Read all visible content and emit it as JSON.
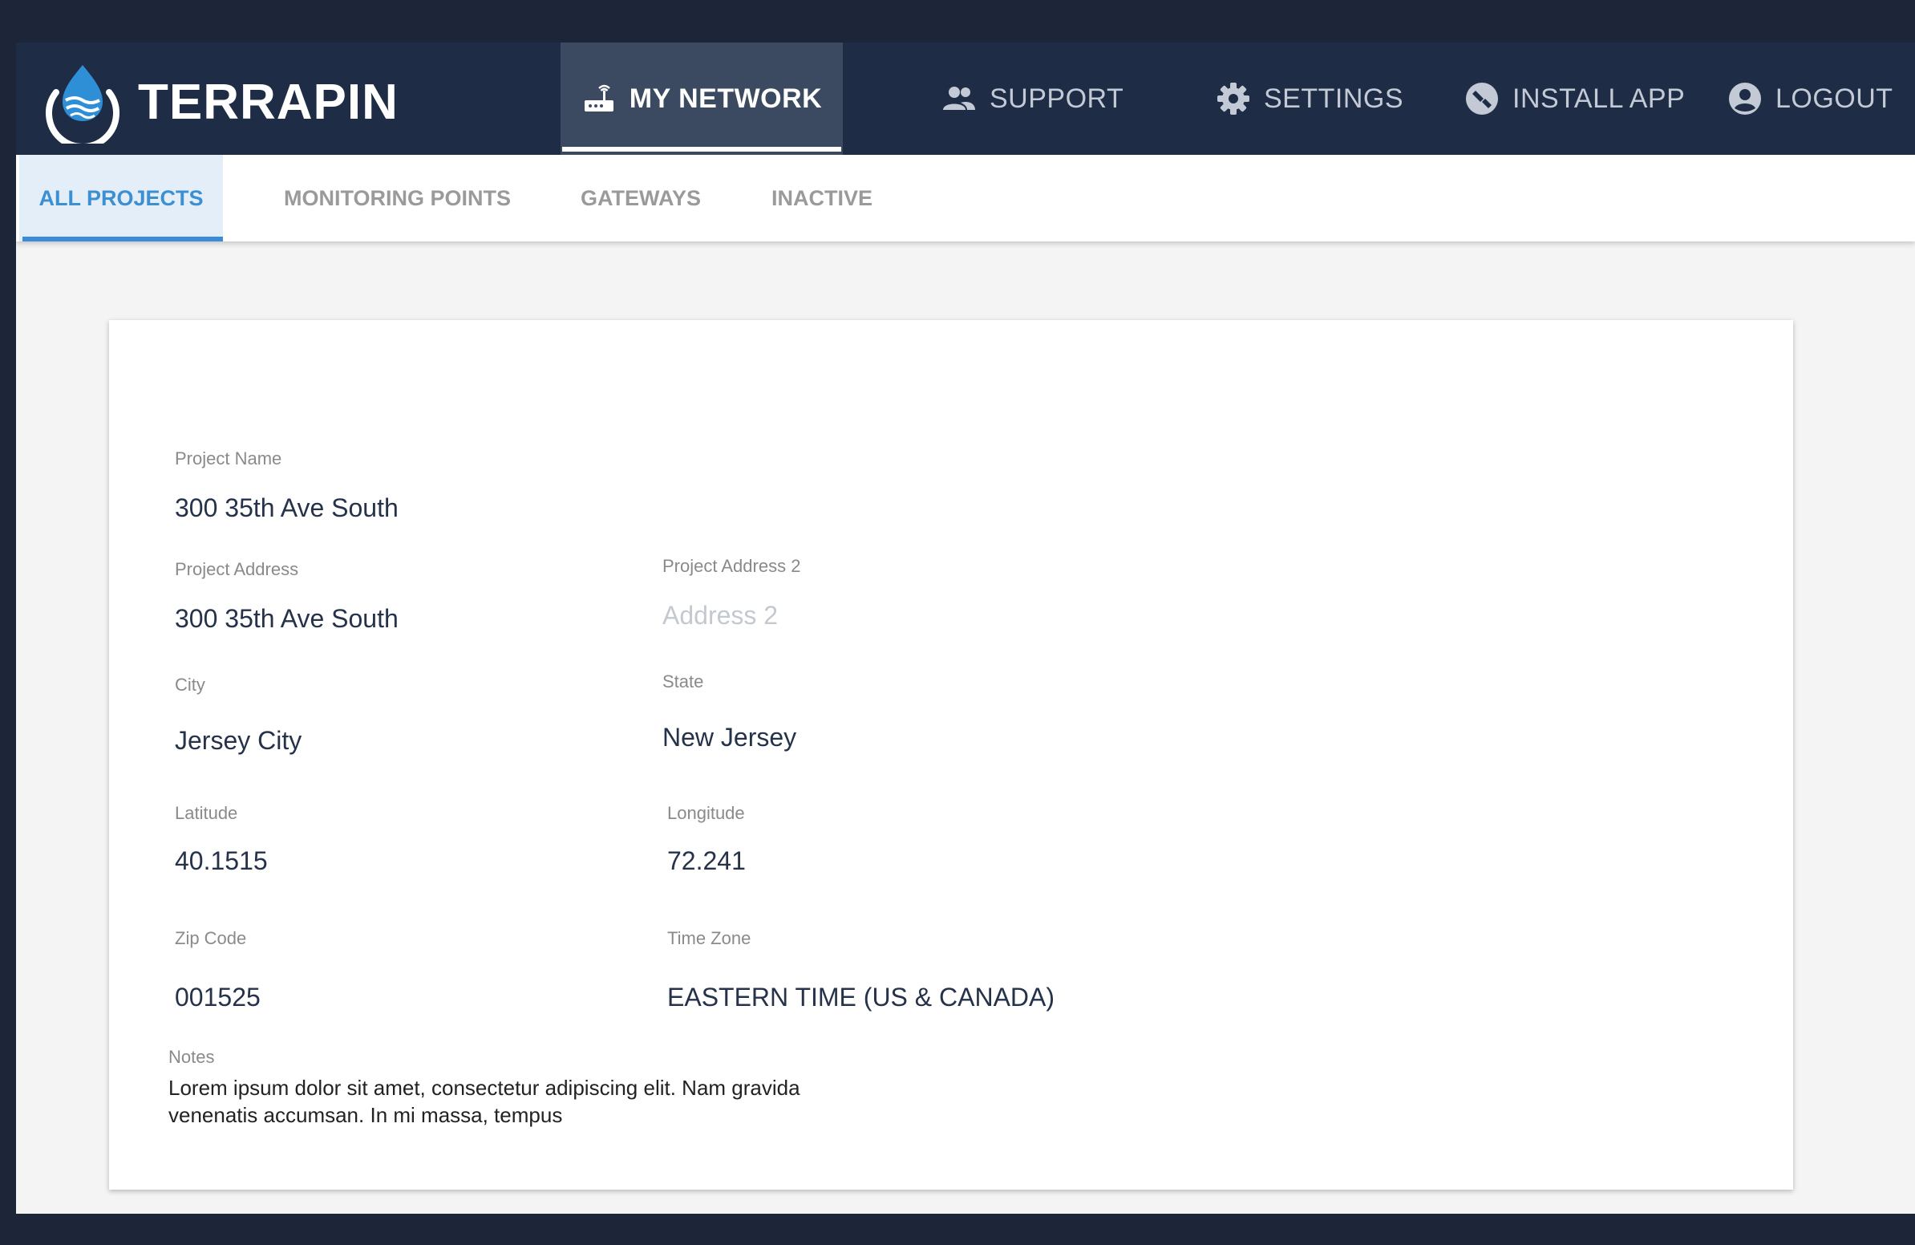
{
  "brand": {
    "name": "TERRAPIN"
  },
  "nav": {
    "items": [
      {
        "label": "MY NETWORK",
        "icon": "router-icon",
        "active": true
      },
      {
        "label": "SUPPORT",
        "icon": "people-icon"
      },
      {
        "label": "SETTINGS",
        "icon": "gear-icon"
      },
      {
        "label": "INSTALL APP",
        "icon": "install-app-icon"
      },
      {
        "label": "LOGOUT",
        "icon": "account-circle-icon"
      }
    ]
  },
  "subnav": {
    "tabs": [
      {
        "label": "ALL PROJECTS",
        "active": true
      },
      {
        "label": "MONITORING POINTS"
      },
      {
        "label": "GATEWAYS"
      },
      {
        "label": "INACTIVE"
      }
    ]
  },
  "form": {
    "project_name": {
      "label": "Project Name",
      "value": "300 35th Ave South"
    },
    "project_address": {
      "label": "Project Address",
      "value": "300 35th Ave South"
    },
    "project_address_2": {
      "label": "Project Address 2",
      "placeholder": "Address 2"
    },
    "city": {
      "label": "City",
      "value": "Jersey City"
    },
    "state": {
      "label": "State",
      "value": "New Jersey"
    },
    "latitude": {
      "label": "Latitude",
      "value": "40.1515"
    },
    "longitude": {
      "label": "Longitude",
      "value": "72.241"
    },
    "zip_code": {
      "label": "Zip Code",
      "value": "001525"
    },
    "time_zone": {
      "label": "Time Zone",
      "value": "EASTERN TIME (US & CANADA)"
    },
    "notes": {
      "label": "Notes",
      "line1": "Lorem ipsum dolor sit amet, consectetur  adipiscing elit. Nam gravida",
      "line2": "venenatis accumsan. In mi massa, tempus"
    }
  },
  "colors": {
    "header_bg": "#1e2d45",
    "active_nav_bg": "#3c4a61",
    "accent": "#3a8cd8",
    "page_bg": "#f4f4f4"
  }
}
